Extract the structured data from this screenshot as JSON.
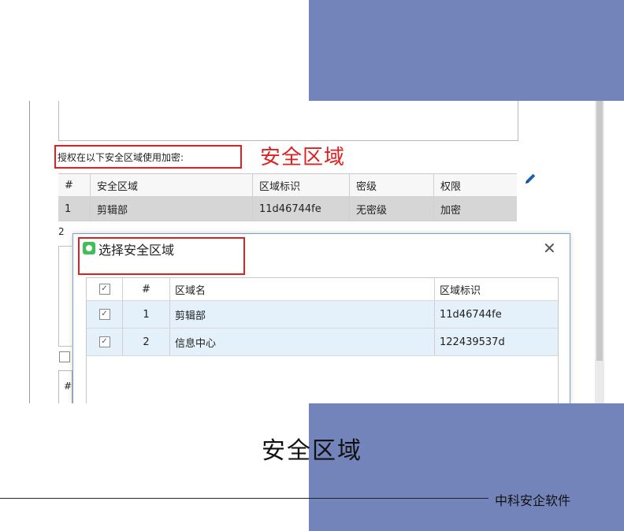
{
  "colors": {
    "blue_block": "#7384ba",
    "red_highlight": "#e02020",
    "selected_row": "#d6d6d6",
    "dialog_row": "#e4f1fb",
    "pencil": "#1a5fb4"
  },
  "form": {
    "auth_label": "授权在以下安全区域使用加密:",
    "callout": "安全区域",
    "edit_icon": "pencil-icon"
  },
  "zone_table": {
    "headers": [
      "#",
      "安全区域",
      "区域标识",
      "密级",
      "权限"
    ],
    "rows": [
      [
        "1",
        "剪辑部",
        "11d46744fe",
        "无密级",
        "加密"
      ]
    ],
    "row2_index": "2"
  },
  "lower_table": {
    "header_hash": "#"
  },
  "dialog": {
    "icon": "app-icon",
    "title": "选择安全区域",
    "close_icon": "close-icon",
    "headers": [
      "#",
      "区域名",
      "区域标识"
    ],
    "rows": [
      {
        "checked": true,
        "index": "1",
        "name": "剪辑部",
        "id": "11d46744fe"
      },
      {
        "checked": true,
        "index": "2",
        "name": "信息中心",
        "id": "122439537d"
      }
    ]
  },
  "caption": "安全区域",
  "footer": "中科安企软件"
}
